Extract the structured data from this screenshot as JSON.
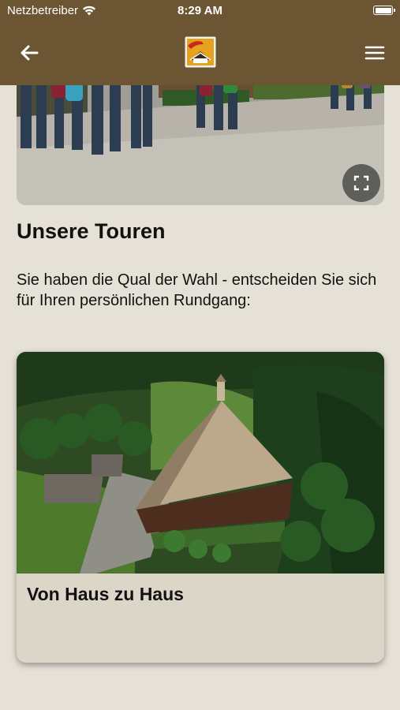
{
  "status_bar": {
    "carrier": "Netzbetreiber",
    "time": "8:29 AM",
    "wifi_icon": "wifi-icon",
    "battery_icon": "battery-icon"
  },
  "nav": {
    "back_icon": "arrow-left-icon",
    "logo": "app-logo",
    "menu_icon": "hamburger-menu-icon",
    "bar_color": "#6b5533"
  },
  "hero": {
    "image": "group-of-visitors-walking-on-gravel-path",
    "fullscreen_icon": "fullscreen-icon"
  },
  "section": {
    "title": "Unsere Touren",
    "intro": "Sie haben die Qual der Wahl - entscheiden Sie sich für Ihren persönlichen Rundgang:"
  },
  "tours": [
    {
      "image": "aerial-view-black-forest-farmhouse",
      "title": "Von Haus zu Haus"
    }
  ],
  "colors": {
    "background": "#e6e1d6",
    "card": "#dcd6c8"
  }
}
